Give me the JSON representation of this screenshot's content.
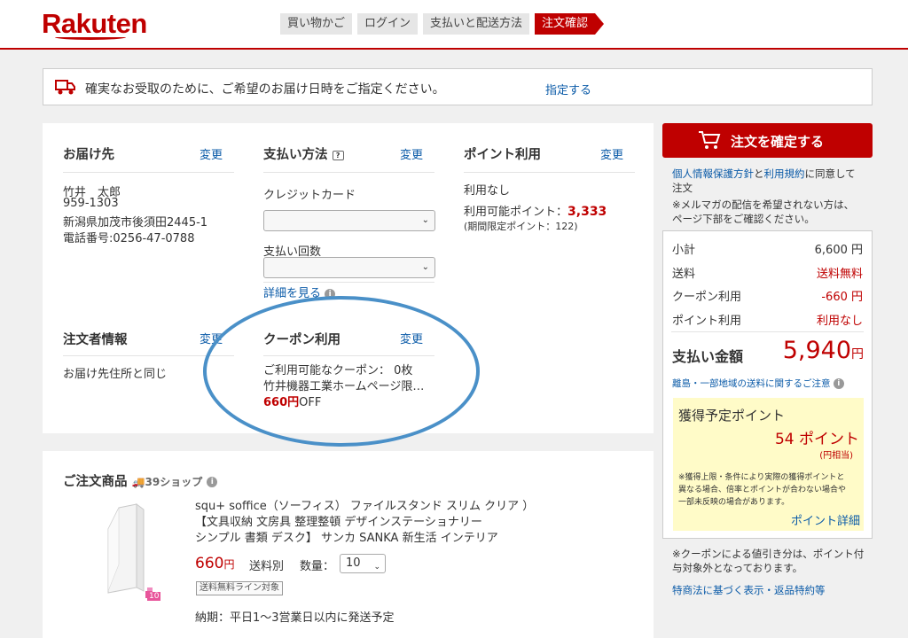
{
  "header": {
    "logo": "Rakuten",
    "steps": [
      "買い物かご",
      "ログイン",
      "支払いと配送方法",
      "注文確認"
    ]
  },
  "notice": {
    "text": "確実なお受取のために、ご希望のお届け日時をご指定ください。",
    "link": "指定する"
  },
  "delivery": {
    "title": "お届け先",
    "change": "変更",
    "name": "竹井　太郎",
    "zip": "959-1303",
    "address": "新潟県加茂市後須田2445-1",
    "phone": "電話番号:0256-47-0788"
  },
  "payment": {
    "title": "支払い方法",
    "change": "変更",
    "method_label": "クレジットカード",
    "installments_label": "支払い回数",
    "details_link": "詳細を見る"
  },
  "points_use": {
    "title": "ポイント利用",
    "change": "変更",
    "status": "利用なし",
    "available_label": "利用可能ポイント：",
    "available_value": "3,333",
    "limited_note": "(期間限定ポイント：122)"
  },
  "orderer": {
    "title": "注文者情報",
    "change": "変更",
    "text": "お届け先住所と同じ"
  },
  "coupon": {
    "title": "クーポン利用",
    "change": "変更",
    "available": "ご利用可能なクーポン： 0枚",
    "coupon_name": "竹井機器工業ホームページ限…",
    "discount_value": "660円",
    "discount_suffix": "OFF"
  },
  "order_items": {
    "title": "ご注文商品",
    "shop_badge": "39ショップ",
    "product_name_line1": "squ+ soffice（ソーフィス） ファイルスタンド スリム クリア ）",
    "product_name_line2": "【文具収納 文房具 整理整頓 デザインステーショナリー",
    "product_name_line3": "シンプル 書類 デスク】 サンカ SANKA 新生活 インテリア",
    "price": "660",
    "price_unit": "円",
    "shipping": "送料別",
    "qty_label": "数量：",
    "qty_value": "10",
    "badge": "送料無料ライン対象",
    "delivery_time": "納期：平日1〜3営業日以内に発送予定",
    "product_image_label": "10"
  },
  "sidebar": {
    "confirm_button": "注文を確定する",
    "agree_link1": "個人情報保護方針",
    "agree_and": "と",
    "agree_link2": "利用規約",
    "agree_suffix": "に同意して",
    "agree_line2": "注文",
    "mailmag_line1": "※メルマガの配信を希望されない方は、",
    "mailmag_line2": "ページ下部をご確認ください。",
    "subtotal_label": "小計",
    "subtotal_value": "6,600 円",
    "shipping_label": "送料",
    "shipping_value": "送料無料",
    "coupon_label": "クーポン利用",
    "coupon_value": "-660 円",
    "point_label": "ポイント利用",
    "point_value": "利用なし",
    "total_label": "支払い金額",
    "total_value": "5,940",
    "total_unit": "円",
    "remote_note": "離島・一部地域の送料に関するご注意",
    "earn_title": "獲得予定ポイント",
    "earn_value": "54 ポイント",
    "earn_equiv": "(円相当)",
    "earn_note_line1": "※獲得上限・条件により実際の獲得ポイントと",
    "earn_note_line2": "異なる場合、倍率とポイントが合わない場合や",
    "earn_note_line3": "一部未反映の場合があります。",
    "earn_link": "ポイント詳細",
    "coupon_note_line1": "※クーポンによる値引き分は、ポイント付",
    "coupon_note_line2": "与対象外となっております。",
    "law_link": "特商法に基づく表示・返品特約等"
  },
  "colors": {
    "brand_red": "#bf0000",
    "link_blue": "#0b5ba8",
    "annotation_blue": "#4a90c8",
    "points_bg": "#fffbc8"
  }
}
